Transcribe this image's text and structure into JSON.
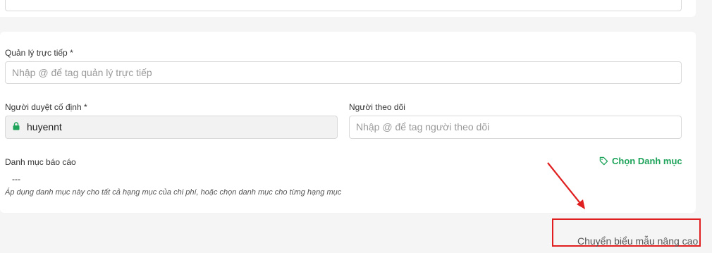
{
  "manager": {
    "label": "Quản lý trực tiếp *",
    "placeholder": "Nhập @ để tag quản lý trực tiếp"
  },
  "approver": {
    "label": "Người duyệt cố định *",
    "value": "huyennt"
  },
  "followers": {
    "label": "Người theo dõi",
    "placeholder": "Nhập @ để tag người theo dõi"
  },
  "category": {
    "label": "Danh mục báo cáo",
    "value": "---",
    "hint": "Áp dụng danh mục này cho tất cả hạng mục của chi phí, hoặc chọn danh mục cho từng hạng mục",
    "choose_label": "Chọn Danh mục"
  },
  "footer": {
    "switch_label": "Chuyển biểu mẫu nâng cao"
  },
  "colors": {
    "accent_green": "#1ea35a",
    "annotation_red": "#e02020"
  }
}
